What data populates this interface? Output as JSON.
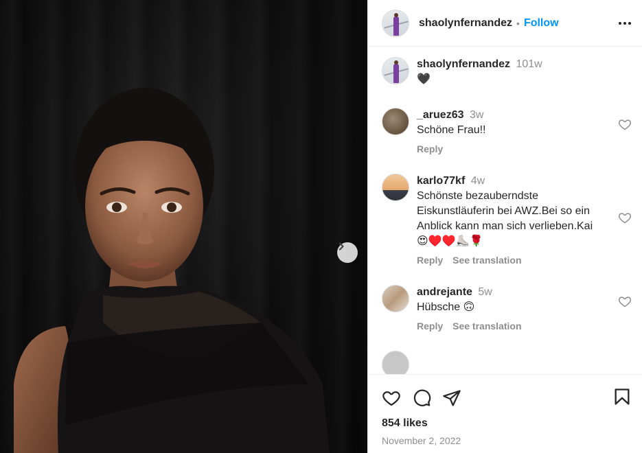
{
  "post": {
    "username": "shaolynfernandez",
    "follow_label": "Follow",
    "separator": "•"
  },
  "caption": {
    "username": "shaolynfernandez",
    "time": "101w",
    "text": "🖤"
  },
  "comments": [
    {
      "username": "_aruez63",
      "time": "3w",
      "text": "Schöne Frau!!",
      "actions": [
        "Reply"
      ]
    },
    {
      "username": "karlo77kf",
      "time": "4w",
      "text": "Schönste bezauberndste Eiskunstläuferin bei AWZ.Bei so ein Anblick kann man sich verlieben.Kai 😍♥️♥️⛸️🌹",
      "actions": [
        "Reply",
        "See translation"
      ]
    },
    {
      "username": "andrejante",
      "time": "5w",
      "text": "Hübsche 🙃",
      "actions": [
        "Reply",
        "See translation"
      ]
    }
  ],
  "footer": {
    "likes": "854 likes",
    "date": "November 2, 2022"
  },
  "icons": {
    "like": "heart-icon",
    "comment": "comment-bubble-icon",
    "share": "paper-plane-icon",
    "save": "bookmark-icon",
    "more": "more-options-icon",
    "next": "chevron-right-icon"
  },
  "colors": {
    "accent": "#0095f6",
    "secondary_text": "#8e8e8e",
    "primary_text": "#262626"
  }
}
